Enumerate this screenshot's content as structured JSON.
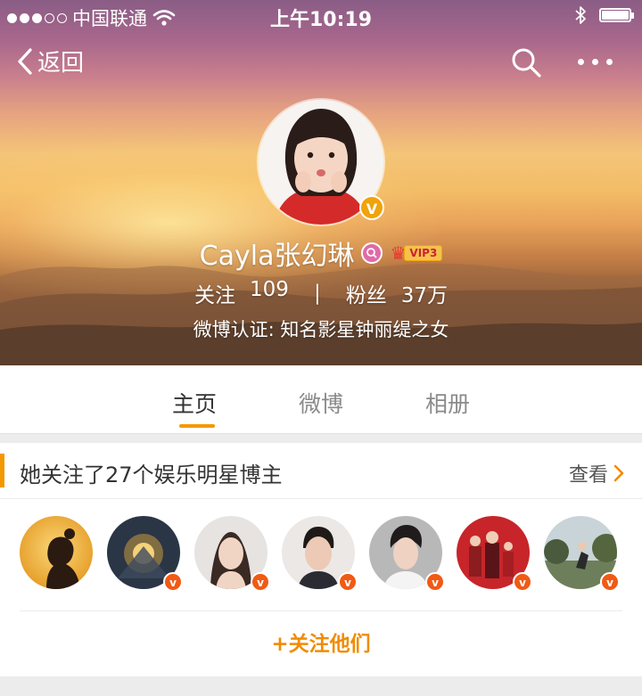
{
  "status_bar": {
    "carrier": "中国联通",
    "time": "上午10:19",
    "signal_dots_filled": 3,
    "signal_dots_total": 5,
    "icons": [
      "wifi-icon",
      "bluetooth-icon",
      "battery-icon"
    ]
  },
  "nav": {
    "back_label": "返回",
    "icons": [
      "chevron-left-icon",
      "search-icon",
      "more-icon"
    ]
  },
  "profile": {
    "name": "Cayla张幻琳",
    "verified_badge": "V",
    "vip_label": "VIP3",
    "following_label": "关注",
    "following_count": "109",
    "separator": "|",
    "followers_label": "粉丝",
    "followers_count": "37万",
    "verification": "微博认证: 知名影星钟丽缇之女"
  },
  "tabs": [
    {
      "label": "主页",
      "active": true
    },
    {
      "label": "微博",
      "active": false
    },
    {
      "label": "相册",
      "active": false
    }
  ],
  "follow_card": {
    "title": "她关注了27个娱乐明星博主",
    "more_label": "查看",
    "badge": "v",
    "follow_all_label": "+关注他们",
    "avatars": [
      {
        "verified": false
      },
      {
        "verified": true
      },
      {
        "verified": true
      },
      {
        "verified": true
      },
      {
        "verified": true
      },
      {
        "verified": true
      },
      {
        "verified": true
      }
    ]
  },
  "colors": {
    "accent": "#f39800",
    "follow_text": "#f08c00",
    "verified_badge": "#f0a30a",
    "small_badge": "#f05a14"
  }
}
